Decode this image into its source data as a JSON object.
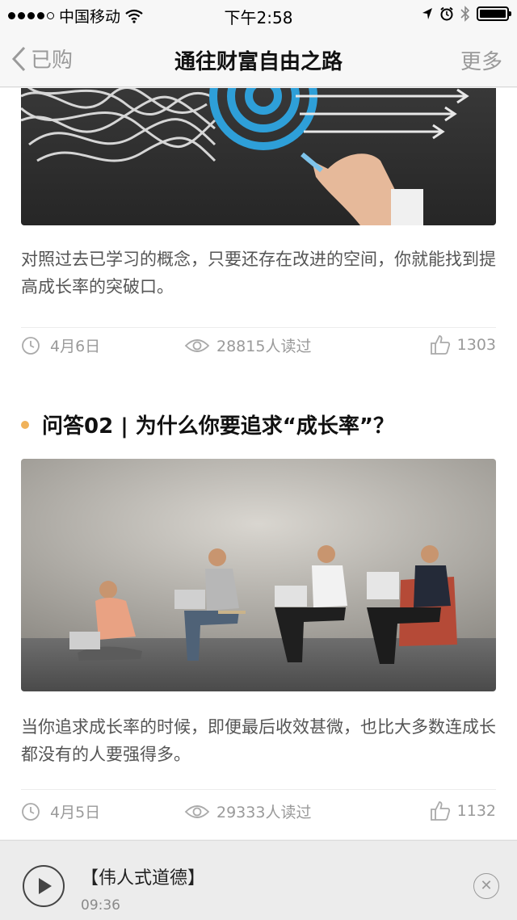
{
  "status_bar": {
    "carrier": "中国移动",
    "time": "下午2:58"
  },
  "nav": {
    "back_label": "已购",
    "title": "通往财富自由之路",
    "more_label": "更多"
  },
  "articles": [
    {
      "description": "对照过去已学习的概念，只要还存在改进的空间，你就能找到提高成长率的突破口。",
      "date": "4月6日",
      "views": "28815人读过",
      "likes": "1303"
    },
    {
      "title": "问答02 | 为什么你要追求“成长率”？",
      "description": "当你追求成长率的时候，即便最后收效甚微，也比大多数连成长都没有的人要强得多。",
      "date": "4月5日",
      "views": "29333人读过",
      "likes": "1132"
    }
  ],
  "player": {
    "title": "【伟人式道德】",
    "time": "09:36"
  },
  "colors": {
    "accent_dot": "#f0b25a",
    "target_blue": "#2e9fd8"
  }
}
